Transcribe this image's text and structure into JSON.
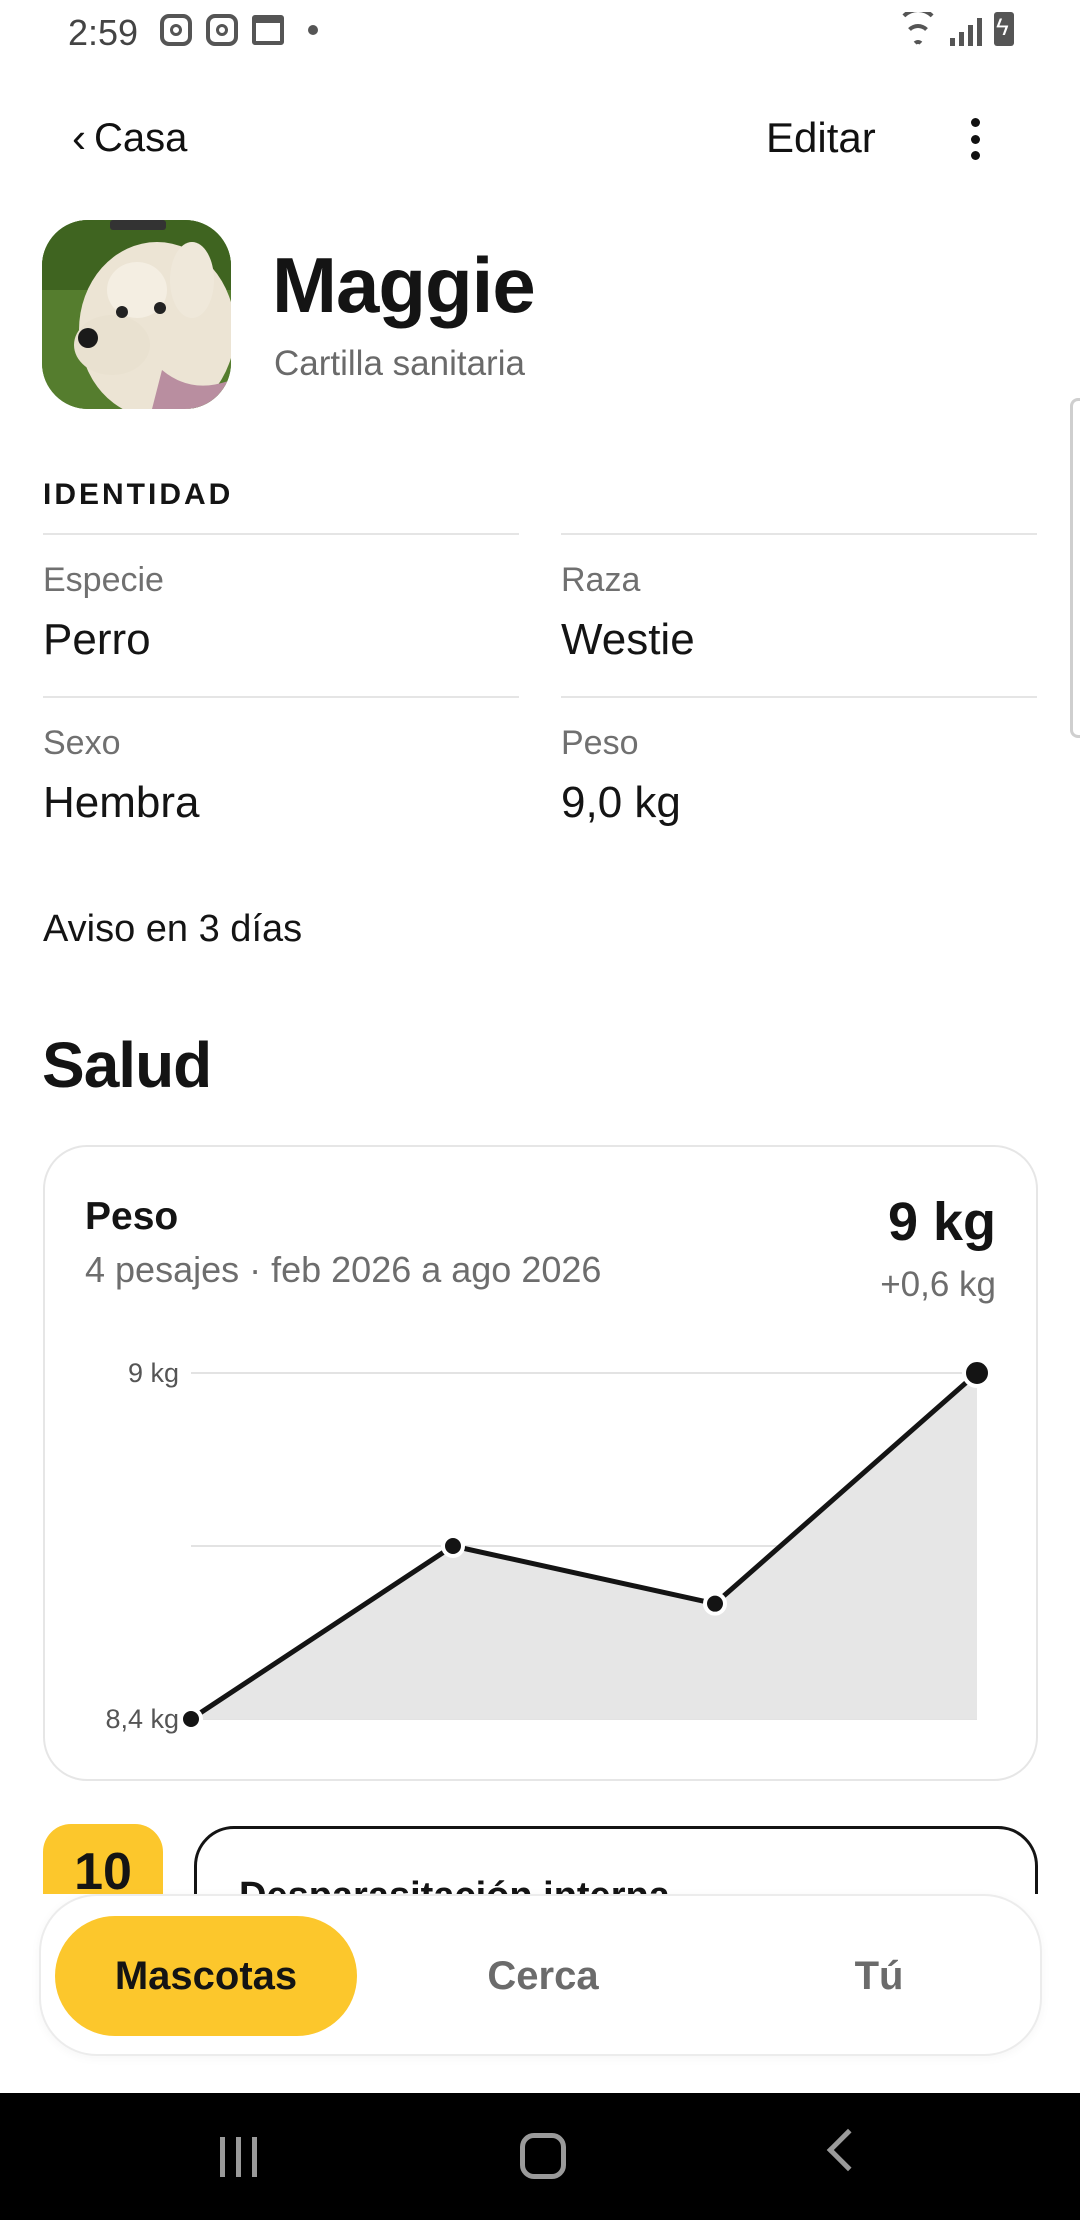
{
  "status_bar": {
    "time": "2:59",
    "left_icons": [
      "instagram-icon",
      "instagram-icon",
      "calendar-icon",
      "dot-icon"
    ],
    "right_icons": [
      "wifi-icon",
      "signal-icon",
      "battery-charging-icon"
    ]
  },
  "header": {
    "back_label": "Casa",
    "edit_label": "Editar",
    "more_icon": "more-vertical-icon"
  },
  "profile": {
    "name": "Maggie",
    "subtitle": "Cartilla sanitaria"
  },
  "identity": {
    "section_label": "IDENTIDAD",
    "fields": [
      {
        "label": "Especie",
        "value": "Perro"
      },
      {
        "label": "Raza",
        "value": "Westie"
      },
      {
        "label": "Sexo",
        "value": "Hembra"
      },
      {
        "label": "Peso",
        "value": "9,0 kg"
      }
    ]
  },
  "notice": "Aviso en 3 días",
  "health": {
    "title": "Salud",
    "weight_card": {
      "title": "Peso",
      "subtitle": "4 pesajes · feb 2026 a ago 2026",
      "value": "9 kg",
      "delta": "+0,6 kg"
    }
  },
  "chart_data": {
    "type": "area",
    "title": "",
    "xlabel": "",
    "ylabel": "",
    "x": [
      1,
      2,
      3,
      4
    ],
    "values": [
      8.4,
      8.7,
      8.6,
      9.0
    ],
    "ylim": [
      8.4,
      9.0
    ],
    "y_tick_labels": [
      "9 kg",
      "8,4 kg"
    ],
    "grid": true,
    "fill_color": "#e6e6e6",
    "line_color": "#141414"
  },
  "next_event": {
    "day": "10",
    "title": "Desparasitación interna"
  },
  "bottom_nav": {
    "items": [
      {
        "label": "Mascotas",
        "active": true
      },
      {
        "label": "Cerca",
        "active": false
      },
      {
        "label": "Tú",
        "active": false
      }
    ]
  },
  "colors": {
    "accent": "#fcc72c",
    "text": "#141414",
    "muted": "#6d6d6d"
  }
}
